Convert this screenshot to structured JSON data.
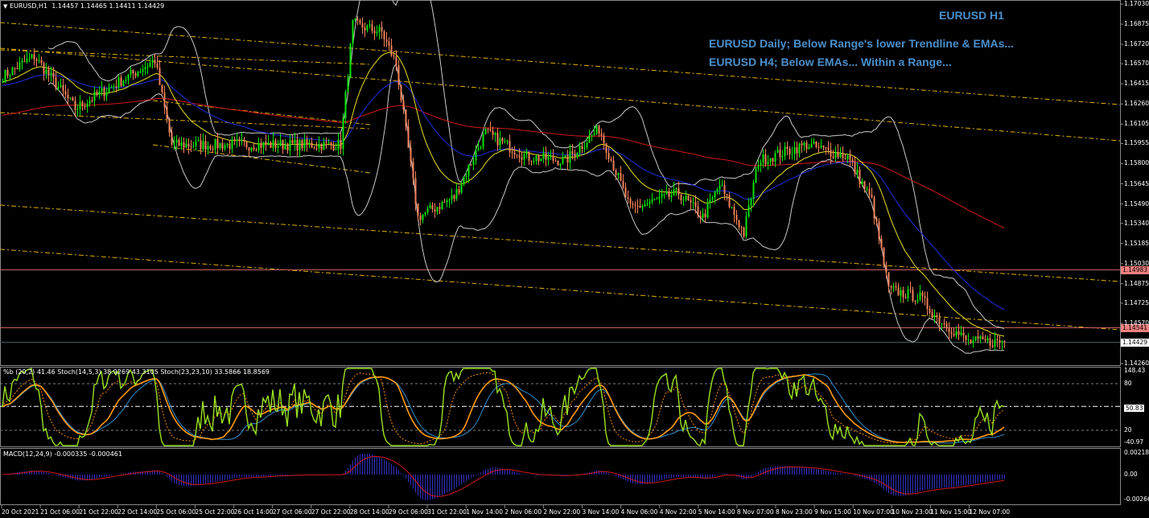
{
  "header": {
    "symbol_menu_icon": "triangle-down-icon",
    "title": "EURUSD,H1",
    "ohlc": "1.14457 1.14465 1.14411 1.14429"
  },
  "notes": {
    "timeframe": "EURUSD H1",
    "line1": "EURUSD Daily; Below Range's lower Trendline & EMAs...",
    "line2": "EURUSD H4; Below EMAs... Within a Range..."
  },
  "indicator_labels": {
    "oscillator": "%b (20,2) 41.46  Stoch(14,5,3) 38.9269 43.3105  Stoch(23,23,10) 33.5866 18.8569",
    "macd": "MACD(12,24,9) -0.000335 -0.000461"
  },
  "colors": {
    "bull": "#00e600",
    "bear": "#f2825a",
    "ema_fast": "#e8e020",
    "ema_mid": "#2030e0",
    "ema_slow": "#d01818",
    "bands": "#c8c8c8",
    "trend": "#e0b000",
    "note": "#4a8fc9",
    "hline": "#c86060"
  },
  "chart_data": [
    {
      "type": "candlestick",
      "title": "EURUSD,H1",
      "ylim": [
        1.1426,
        1.1703
      ],
      "y_ticks": [
        "1.17030",
        "1.16875",
        "1.16720",
        "1.16570",
        "1.16415",
        "1.16260",
        "1.16105",
        "1.15955",
        "1.15800",
        "1.15645",
        "1.15490",
        "1.15340",
        "1.15185",
        "1.15030",
        "1.14875",
        "1.14725",
        "1.14570",
        "1.14260"
      ],
      "x_ticks": [
        "20 Oct 2021",
        "21 Oct 06:00",
        "21 Oct 22:00",
        "22 Oct 14:00",
        "25 Oct 06:00",
        "25 Oct 22:00",
        "26 Oct 14:00",
        "27 Oct 06:00",
        "27 Oct 22:00",
        "28 Oct 14:00",
        "29 Oct 06:00",
        "31 Oct 22:00",
        "1 Nov 14:00",
        "2 Nov 06:00",
        "2 Nov 22:00",
        "3 Nov 14:00",
        "4 Nov 06:00",
        "4 Nov 22:00",
        "5 Nov 14:00",
        "8 Nov 07:00",
        "8 Nov 23:00",
        "9 Nov 15:00",
        "10 Nov 07:00",
        "10 Nov 23:00",
        "11 Nov 15:00",
        "12 Nov 07:00"
      ],
      "close_path": [
        [
          0,
          1.16472
        ],
        [
          13,
          1.16627
        ],
        [
          30,
          1.16224
        ],
        [
          63,
          1.16596
        ],
        [
          70,
          1.15946
        ],
        [
          97,
          1.15946
        ],
        [
          140,
          1.15946
        ],
        [
          145,
          1.16875
        ],
        [
          157,
          1.16813
        ],
        [
          163,
          1.16565
        ],
        [
          172,
          1.15388
        ],
        [
          187,
          1.15543
        ],
        [
          200,
          1.16039
        ],
        [
          217,
          1.15853
        ],
        [
          233,
          1.15822
        ],
        [
          247,
          1.1607
        ],
        [
          260,
          1.1545
        ],
        [
          280,
          1.15574
        ],
        [
          290,
          1.15388
        ],
        [
          297,
          1.15636
        ],
        [
          307,
          1.15264
        ],
        [
          313,
          1.15822
        ],
        [
          333,
          1.15946
        ],
        [
          350,
          1.15853
        ],
        [
          360,
          1.15512
        ],
        [
          367,
          1.1483
        ],
        [
          380,
          1.14768
        ],
        [
          387,
          1.14613
        ],
        [
          400,
          1.14427
        ],
        [
          415,
          1.14429
        ]
      ],
      "price_lines": [
        {
          "label": "1.14983",
          "value": 1.14983,
          "style": "red"
        },
        {
          "label": "1.14541",
          "value": 1.14541,
          "style": "red"
        },
        {
          "label": "1.14429",
          "value": 1.14429,
          "style": "current"
        }
      ]
    },
    {
      "type": "line",
      "title": "%b / Stochastic",
      "y_ticks": [
        "148.43",
        "80",
        "50.83",
        "20",
        "-40.97"
      ],
      "levels": [
        80,
        50.83,
        20
      ]
    },
    {
      "type": "bar",
      "title": "MACD(12,24,9)",
      "y_ticks": [
        "0.002181",
        "0.00",
        "-0.002667"
      ],
      "ylim": [
        -0.002667,
        0.002181
      ]
    }
  ]
}
